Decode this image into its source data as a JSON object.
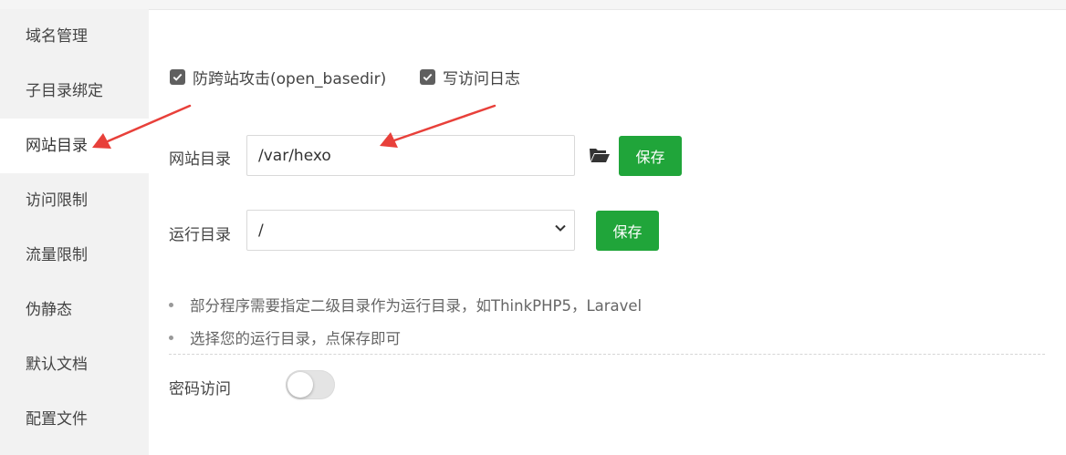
{
  "sidebar": {
    "items": [
      {
        "label": "域名管理"
      },
      {
        "label": "子目录绑定"
      },
      {
        "label": "网站目录",
        "active": true
      },
      {
        "label": "访问限制"
      },
      {
        "label": "流量限制"
      },
      {
        "label": "伪静态"
      },
      {
        "label": "默认文档"
      },
      {
        "label": "配置文件"
      }
    ]
  },
  "options": {
    "anti_xss": {
      "label": "防跨站攻击(open_basedir)",
      "checked": true
    },
    "access_log": {
      "label": "写访问日志",
      "checked": true
    }
  },
  "site_dir": {
    "label": "网站目录",
    "value": "/var/hexo",
    "folder_icon": "folder-open-icon",
    "save_label": "保存"
  },
  "run_dir": {
    "label": "运行目录",
    "selected": "/",
    "save_label": "保存"
  },
  "tips": [
    "部分程序需要指定二级目录作为运行目录，如ThinkPHP5，Laravel",
    "选择您的运行目录，点保存即可"
  ],
  "password_access": {
    "label": "密码访问",
    "enabled": false
  },
  "colors": {
    "primary_green": "#20a53a",
    "annotation_red": "#e8403a",
    "sidebar_bg": "#f2f2f2"
  }
}
